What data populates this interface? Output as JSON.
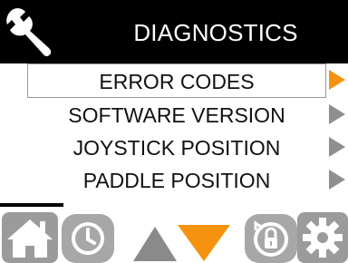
{
  "header": {
    "title": "DIAGNOSTICS",
    "icon": "wrench-icon"
  },
  "menu": {
    "items": [
      {
        "label": "ERROR CODES",
        "selected": true
      },
      {
        "label": "SOFTWARE VERSION",
        "selected": false
      },
      {
        "label": "JOYSTICK POSITION",
        "selected": false
      },
      {
        "label": "PADDLE POSITION",
        "selected": false
      }
    ]
  },
  "nav": {
    "buttons": [
      {
        "name": "home-icon"
      },
      {
        "name": "clock-icon"
      },
      {
        "name": "up-arrow-icon"
      },
      {
        "name": "down-arrow-icon"
      },
      {
        "name": "lock-icon"
      },
      {
        "name": "gear-icon"
      }
    ]
  },
  "colors": {
    "accent": "#f5930f",
    "header_bg": "#000000",
    "nav_gray": "#9b9b9b",
    "arrow_gray": "#8f8f8f"
  }
}
